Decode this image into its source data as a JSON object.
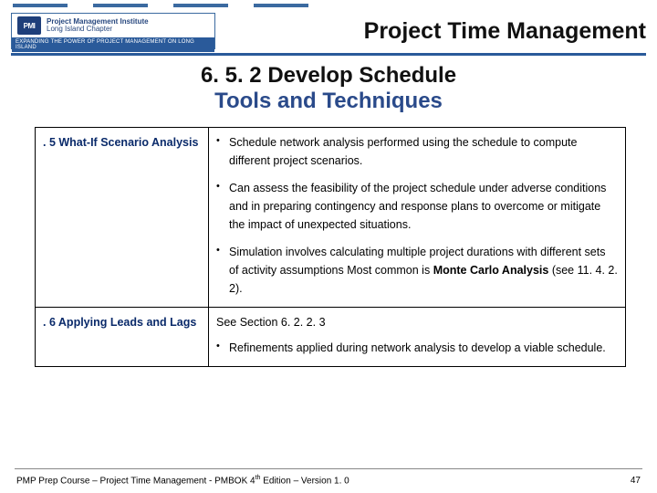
{
  "logo": {
    "badge": "PMI",
    "line1": "Project Management Institute",
    "line2": "Long Island Chapter",
    "band": "Expanding the Power of Project Management on Long Island"
  },
  "header": {
    "title": "Project Time Management"
  },
  "subhead": {
    "line1": "6. 5. 2  Develop Schedule",
    "line2": "Tools and Techniques"
  },
  "rows": [
    {
      "label": ". 5  What-If Scenario Analysis",
      "see": "",
      "bullets": [
        "Schedule network analysis performed using the schedule to compute different project scenarios.",
        "Can assess the feasibility of the project schedule under adverse conditions and in preparing contingency and response plans to overcome or mitigate the impact of unexpected situations.",
        "Simulation involves calculating multiple project durations with different sets of activity assumptions Most common is <b>Monte Carlo Analysis</b> (see 11. 4. 2. 2)."
      ]
    },
    {
      "label": ". 6  Applying Leads and Lags",
      "see": "See Section 6. 2. 2. 3",
      "bullets": [
        "Refinements applied during network analysis to develop a viable schedule."
      ]
    }
  ],
  "footer": {
    "left_prefix": "PMP Prep Course – Project Time Management - PMBOK 4",
    "left_suffix": " Edition – Version 1. 0",
    "page": "47"
  }
}
